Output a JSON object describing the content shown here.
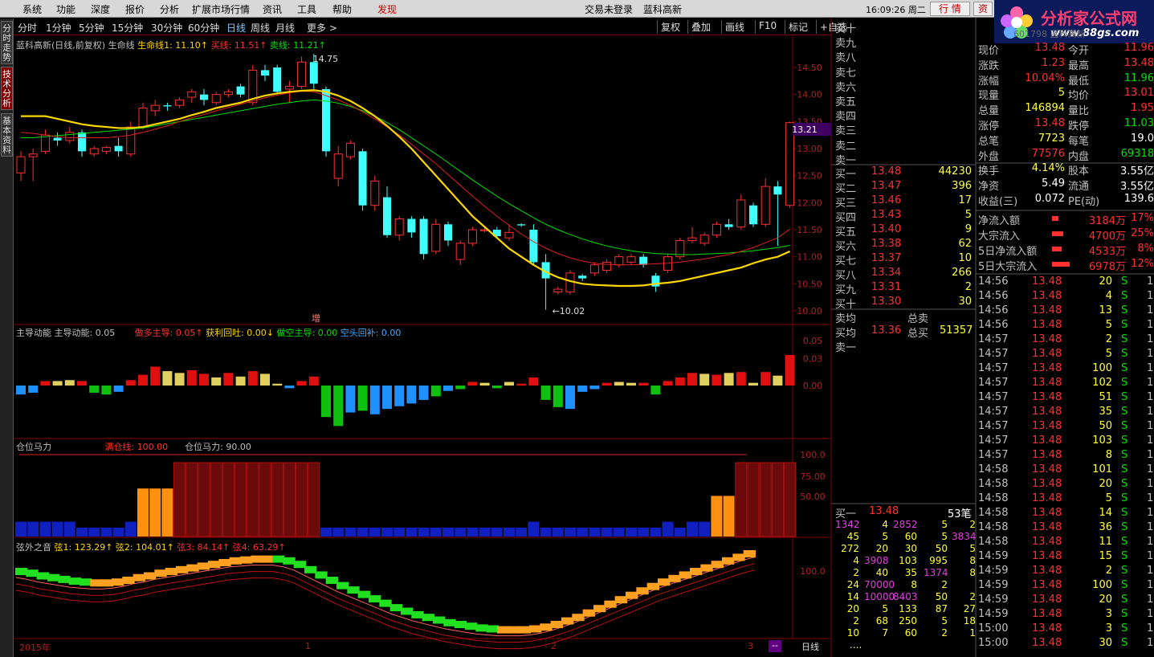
{
  "menu": [
    "系统",
    "功能",
    "深度",
    "报价",
    "分析",
    "扩展市场行情",
    "资讯",
    "工具",
    "帮助",
    "发现"
  ],
  "login_status": "交易未登录",
  "stock_name": "蓝科高新",
  "clock": "16:09:26 周二",
  "btn_quote": "行 情",
  "btn_trade": "资",
  "logo": {
    "name": "分析家公式网",
    "url": "www.88gs.com"
  },
  "left_tabs": [
    "分时走势",
    "技术分析",
    "基本资料"
  ],
  "periods": [
    "分时",
    "1分钟",
    "5分钟",
    "15分钟",
    "30分钟",
    "60分钟",
    "日线",
    "周线",
    "月线",
    "更多 >"
  ],
  "active_period": "日线",
  "tools": [
    "复权",
    "叠加",
    "画线",
    "F10",
    "标记",
    "+自选"
  ],
  "main_panel": {
    "title": "蓝科高新(日线,前复权) 生命线",
    "ind1": "生命线1: 11.10↑",
    "ind2": "买线: 11.51↑",
    "ind3": "卖线: 11.21↑",
    "high_mark": "14.75",
    "low_mark": "10.02",
    "tag": "增",
    "price_tag": "13.21",
    "y_ticks": [
      "14.50",
      "14.00",
      "13.50",
      "13.00",
      "12.50",
      "12.00",
      "11.50",
      "11.00",
      "10.50",
      "10.00"
    ]
  },
  "momentum_panel": {
    "title": "主导动能",
    "v1": "主导动能: 0.05",
    "v2": "做多主导: 0.05↑",
    "v3": "获利回吐: 0.00↓",
    "v4": "做空主导: 0.00",
    "v5": "空头回补: 0.00",
    "y_ticks": [
      "0.05",
      "0.03",
      "0.00"
    ]
  },
  "position_panel": {
    "title": "仓位马力",
    "v1": "满仓线: 100.00",
    "v2": "仓位马力: 90.00",
    "y_ticks": [
      "100.0",
      "75.00",
      "50.00"
    ]
  },
  "string_panel": {
    "title": "弦外之音",
    "v1": "弦1: 123.29↑",
    "v2": "弦2: 104.01↑",
    "v3": "弦3: 84.14↑",
    "v4": "弦4: 63.29↑",
    "y_ticks": [
      "100.0"
    ]
  },
  "x_axis": {
    "year": "2015年",
    "m1": "1",
    "m2": "2",
    "m3": "3",
    "period": "日线",
    "more": "--"
  },
  "colors": {
    "up": "#ff3030",
    "down": "#40ffff",
    "yellow": "#ffd700",
    "green": "#00e000",
    "grid": "#800000"
  },
  "chart_data": {
    "type": "candlestick",
    "series": [
      {
        "o": 12.55,
        "h": 12.95,
        "l": 12.4,
        "c": 12.85
      },
      {
        "o": 12.85,
        "h": 13.0,
        "l": 12.4,
        "c": 12.9
      },
      {
        "o": 12.95,
        "h": 13.35,
        "l": 12.9,
        "c": 13.25
      },
      {
        "o": 13.2,
        "h": 13.3,
        "l": 13.05,
        "c": 13.15
      },
      {
        "o": 13.15,
        "h": 13.4,
        "l": 13.1,
        "c": 13.3
      },
      {
        "o": 13.3,
        "h": 13.35,
        "l": 12.85,
        "c": 12.95
      },
      {
        "o": 12.9,
        "h": 13.05,
        "l": 12.85,
        "c": 13.0
      },
      {
        "o": 12.95,
        "h": 13.05,
        "l": 12.9,
        "c": 13.02
      },
      {
        "o": 13.05,
        "h": 13.2,
        "l": 12.85,
        "c": 12.95
      },
      {
        "o": 12.9,
        "h": 13.5,
        "l": 12.85,
        "c": 13.4
      },
      {
        "o": 13.4,
        "h": 13.85,
        "l": 13.35,
        "c": 13.75
      },
      {
        "o": 13.7,
        "h": 13.9,
        "l": 13.6,
        "c": 13.8
      },
      {
        "o": 13.8,
        "h": 13.85,
        "l": 13.7,
        "c": 13.78
      },
      {
        "o": 13.8,
        "h": 13.95,
        "l": 13.75,
        "c": 13.9
      },
      {
        "o": 13.95,
        "h": 14.1,
        "l": 13.85,
        "c": 14.05
      },
      {
        "o": 14.0,
        "h": 14.1,
        "l": 13.8,
        "c": 13.9
      },
      {
        "o": 13.85,
        "h": 14.05,
        "l": 13.8,
        "c": 14.0
      },
      {
        "o": 14.0,
        "h": 14.1,
        "l": 13.95,
        "c": 14.05
      },
      {
        "o": 14.15,
        "h": 14.2,
        "l": 13.95,
        "c": 14.0
      },
      {
        "o": 13.85,
        "h": 14.55,
        "l": 13.8,
        "c": 14.45
      },
      {
        "o": 14.45,
        "h": 14.55,
        "l": 14.25,
        "c": 14.35
      },
      {
        "o": 14.5,
        "h": 14.55,
        "l": 14.0,
        "c": 14.05
      },
      {
        "o": 14.1,
        "h": 14.25,
        "l": 13.85,
        "c": 14.15
      },
      {
        "o": 14.15,
        "h": 14.7,
        "l": 14.1,
        "c": 14.6
      },
      {
        "o": 14.6,
        "h": 14.75,
        "l": 14.1,
        "c": 14.2
      },
      {
        "o": 14.1,
        "h": 14.15,
        "l": 12.85,
        "c": 12.95
      },
      {
        "o": 12.45,
        "h": 13.05,
        "l": 12.3,
        "c": 12.9
      },
      {
        "o": 12.85,
        "h": 13.15,
        "l": 12.8,
        "c": 13.1
      },
      {
        "o": 12.95,
        "h": 13.0,
        "l": 11.85,
        "c": 11.95
      },
      {
        "o": 11.95,
        "h": 12.5,
        "l": 11.85,
        "c": 12.4
      },
      {
        "o": 12.1,
        "h": 12.3,
        "l": 11.35,
        "c": 11.4
      },
      {
        "o": 11.4,
        "h": 11.75,
        "l": 11.3,
        "c": 11.7
      },
      {
        "o": 11.7,
        "h": 11.75,
        "l": 11.35,
        "c": 11.45
      },
      {
        "o": 11.7,
        "h": 11.75,
        "l": 10.95,
        "c": 11.05
      },
      {
        "o": 11.1,
        "h": 11.7,
        "l": 11.05,
        "c": 11.6
      },
      {
        "o": 11.6,
        "h": 11.65,
        "l": 11.2,
        "c": 11.3
      },
      {
        "o": 10.95,
        "h": 11.3,
        "l": 10.85,
        "c": 11.25
      },
      {
        "o": 11.25,
        "h": 11.55,
        "l": 11.2,
        "c": 11.5
      },
      {
        "o": 11.48,
        "h": 11.55,
        "l": 11.45,
        "c": 11.5
      },
      {
        "o": 11.5,
        "h": 11.55,
        "l": 11.35,
        "c": 11.38
      },
      {
        "o": 11.35,
        "h": 11.6,
        "l": 11.3,
        "c": 11.45
      },
      {
        "o": 11.6,
        "h": 11.62,
        "l": 11.55,
        "c": 11.58
      },
      {
        "o": 11.5,
        "h": 11.6,
        "l": 10.85,
        "c": 10.9
      },
      {
        "o": 10.9,
        "h": 11.05,
        "l": 10.02,
        "c": 10.6
      },
      {
        "o": 10.35,
        "h": 10.45,
        "l": 10.3,
        "c": 10.4
      },
      {
        "o": 10.35,
        "h": 10.75,
        "l": 10.3,
        "c": 10.7
      },
      {
        "o": 10.65,
        "h": 10.68,
        "l": 10.55,
        "c": 10.6
      },
      {
        "o": 10.7,
        "h": 10.9,
        "l": 10.65,
        "c": 10.85
      },
      {
        "o": 10.75,
        "h": 10.95,
        "l": 10.7,
        "c": 10.9
      },
      {
        "o": 10.85,
        "h": 11.05,
        "l": 10.8,
        "c": 11.0
      },
      {
        "o": 10.9,
        "h": 11.05,
        "l": 10.85,
        "c": 11.0
      },
      {
        "o": 11.0,
        "h": 11.05,
        "l": 10.8,
        "c": 10.85
      },
      {
        "o": 10.65,
        "h": 10.7,
        "l": 10.35,
        "c": 10.45
      },
      {
        "o": 10.75,
        "h": 11.05,
        "l": 10.7,
        "c": 11.0
      },
      {
        "o": 11.0,
        "h": 11.35,
        "l": 10.95,
        "c": 11.3
      },
      {
        "o": 11.3,
        "h": 11.55,
        "l": 11.25,
        "c": 11.35
      },
      {
        "o": 11.25,
        "h": 11.45,
        "l": 11.2,
        "c": 11.4
      },
      {
        "o": 11.4,
        "h": 11.65,
        "l": 11.35,
        "c": 11.6
      },
      {
        "o": 11.6,
        "h": 11.7,
        "l": 11.5,
        "c": 11.55
      },
      {
        "o": 11.55,
        "h": 12.15,
        "l": 11.5,
        "c": 12.05
      },
      {
        "o": 11.95,
        "h": 12.0,
        "l": 11.55,
        "c": 11.6
      },
      {
        "o": 11.6,
        "h": 12.45,
        "l": 11.55,
        "c": 12.3
      },
      {
        "o": 12.3,
        "h": 12.4,
        "l": 11.2,
        "c": 12.15
      },
      {
        "o": 11.95,
        "h": 13.5,
        "l": 11.9,
        "c": 13.48
      }
    ],
    "lifeline": [
      13.6,
      13.6,
      13.6,
      13.55,
      13.5,
      13.45,
      13.42,
      13.4,
      13.38,
      13.38,
      13.4,
      13.45,
      13.5,
      13.55,
      13.62,
      13.68,
      13.75,
      13.8,
      13.85,
      13.92,
      13.98,
      14.02,
      14.05,
      14.07,
      14.08,
      14.05,
      13.98,
      13.88,
      13.75,
      13.6,
      13.42,
      13.22,
      13.0,
      12.75,
      12.5,
      12.25,
      12.0,
      11.75,
      11.55,
      11.35,
      11.15,
      11.0,
      10.85,
      10.72,
      10.62,
      10.55,
      10.5,
      10.48,
      10.47,
      10.46,
      10.46,
      10.47,
      10.5,
      10.52,
      10.55,
      10.6,
      10.65,
      10.7,
      10.75,
      10.8,
      10.88,
      10.95,
      11.0,
      11.1
    ],
    "buyline": [
      13.3,
      13.28,
      13.25,
      13.22,
      13.2,
      13.2,
      13.2,
      13.2,
      13.22,
      13.25,
      13.3,
      13.36,
      13.42,
      13.5,
      13.57,
      13.63,
      13.7,
      13.76,
      13.82,
      13.88,
      13.94,
      13.99,
      14.03,
      14.06,
      14.05,
      13.98,
      13.9,
      13.8,
      13.68,
      13.55,
      13.4,
      13.25,
      13.08,
      12.9,
      12.72,
      12.52,
      12.32,
      12.12,
      11.93,
      11.75,
      11.58,
      11.42,
      11.28,
      11.16,
      11.06,
      10.98,
      10.92,
      10.88,
      10.86,
      10.85,
      10.85,
      10.86,
      10.87,
      10.88,
      10.9,
      10.93,
      10.96,
      11.0,
      11.04,
      11.1,
      11.17,
      11.26,
      11.35,
      11.51
    ],
    "sellline": [
      13.2,
      13.2,
      13.22,
      13.24,
      13.26,
      13.28,
      13.3,
      13.32,
      13.34,
      13.36,
      13.38,
      13.42,
      13.46,
      13.5,
      13.54,
      13.58,
      13.62,
      13.66,
      13.7,
      13.74,
      13.78,
      13.82,
      13.85,
      13.88,
      13.9,
      13.88,
      13.84,
      13.78,
      13.7,
      13.6,
      13.48,
      13.35,
      13.2,
      13.05,
      12.9,
      12.74,
      12.58,
      12.42,
      12.27,
      12.12,
      11.98,
      11.85,
      11.72,
      11.6,
      11.5,
      11.41,
      11.33,
      11.26,
      11.2,
      11.15,
      11.11,
      11.08,
      11.06,
      11.05,
      11.04,
      11.04,
      11.05,
      11.06,
      11.07,
      11.09,
      11.11,
      11.14,
      11.17,
      11.21
    ],
    "momentum": [
      -0.01,
      -0.008,
      0.005,
      0.005,
      0.006,
      0.005,
      -0.008,
      -0.01,
      -0.007,
      0.006,
      0.012,
      0.021,
      0.016,
      0.014,
      0.017,
      0.013,
      0.009,
      0.014,
      0.01,
      0.016,
      0.013,
      0.002,
      -0.003,
      0.005,
      0.01,
      -0.035,
      -0.045,
      -0.03,
      -0.028,
      -0.032,
      -0.026,
      -0.023,
      -0.02,
      -0.016,
      -0.012,
      -0.006,
      -0.004,
      0.004,
      0.003,
      -0.003,
      0.004,
      0.002,
      0.009,
      -0.016,
      -0.024,
      -0.026,
      -0.007,
      -0.004,
      0.003,
      0.004,
      0.003,
      0.003,
      -0.01,
      0.005,
      0.009,
      0.014,
      0.013,
      0.012,
      0.014,
      0.015,
      0.003,
      0.015,
      0.011,
      0.034
    ],
    "momentum_colors": [
      "b",
      "b",
      "r",
      "y",
      "y",
      "r",
      "g",
      "g",
      "b",
      "r",
      "r",
      "r",
      "y",
      "y",
      "r",
      "r",
      "y",
      "r",
      "y",
      "r",
      "y",
      "y",
      "b",
      "r",
      "r",
      "g",
      "g",
      "b",
      "g",
      "b",
      "b",
      "b",
      "b",
      "b",
      "g",
      "b",
      "g",
      "r",
      "y",
      "g",
      "y",
      "r",
      "r",
      "g",
      "g",
      "b",
      "b",
      "b",
      "r",
      "y",
      "y",
      "r",
      "g",
      "r",
      "r",
      "r",
      "y",
      "r",
      "y",
      "r",
      "y",
      "r",
      "y",
      "r"
    ],
    "position": [
      20,
      20,
      20,
      20,
      20,
      12,
      12,
      12,
      12,
      20,
      65,
      65,
      65,
      100,
      100,
      100,
      100,
      100,
      100,
      100,
      100,
      100,
      100,
      100,
      100,
      12,
      12,
      12,
      12,
      12,
      12,
      12,
      12,
      12,
      12,
      12,
      12,
      12,
      12,
      12,
      12,
      12,
      20,
      12,
      12,
      12,
      12,
      12,
      12,
      12,
      12,
      12,
      12,
      20,
      12,
      20,
      20,
      55,
      55,
      100,
      100,
      100,
      100,
      100,
      100
    ],
    "position_colors": [
      "b",
      "b",
      "b",
      "b",
      "b",
      "b",
      "b",
      "b",
      "b",
      "b",
      "o",
      "o",
      "o",
      "m",
      "m",
      "m",
      "m",
      "m",
      "m",
      "m",
      "m",
      "m",
      "m",
      "m",
      "m",
      "b",
      "b",
      "b",
      "b",
      "b",
      "b",
      "b",
      "b",
      "b",
      "b",
      "b",
      "b",
      "b",
      "b",
      "b",
      "b",
      "b",
      "b",
      "b",
      "b",
      "b",
      "b",
      "b",
      "b",
      "b",
      "b",
      "b",
      "b",
      "b",
      "b",
      "b",
      "b",
      "o",
      "o",
      "m",
      "m",
      "m",
      "m",
      "m",
      "m"
    ],
    "strings": [
      100,
      98,
      95,
      93,
      91,
      89,
      88,
      87,
      87,
      88,
      90,
      93,
      95,
      98,
      100,
      102,
      104,
      106,
      108,
      110,
      112,
      113,
      114,
      114,
      114,
      112,
      108,
      102,
      96,
      90,
      84,
      79,
      74,
      69,
      64,
      59,
      55,
      51,
      48,
      45,
      42,
      40,
      38,
      36,
      35,
      34,
      34,
      34,
      35,
      37,
      40,
      44,
      48,
      53,
      58,
      63,
      68,
      73,
      78,
      83,
      88,
      92,
      96,
      100,
      104,
      108,
      112,
      116,
      120,
      123
    ]
  },
  "order_book": {
    "sell": [
      [
        "卖十",
        "",
        ""
      ],
      [
        "卖九",
        "",
        ""
      ],
      [
        "卖八",
        "",
        ""
      ],
      [
        "卖七",
        "",
        ""
      ],
      [
        "卖六",
        "",
        ""
      ],
      [
        "卖五",
        "",
        ""
      ],
      [
        "卖四",
        "",
        ""
      ],
      [
        "卖三",
        "",
        ""
      ],
      [
        "卖二",
        "",
        ""
      ],
      [
        "卖一",
        "",
        ""
      ]
    ],
    "buy": [
      [
        "买一",
        "13.48",
        "44230"
      ],
      [
        "买二",
        "13.47",
        "396"
      ],
      [
        "买三",
        "13.46",
        "17"
      ],
      [
        "买四",
        "13.43",
        "5"
      ],
      [
        "买五",
        "13.40",
        "9"
      ],
      [
        "买六",
        "13.38",
        "62"
      ],
      [
        "买七",
        "13.37",
        "10"
      ],
      [
        "买八",
        "13.34",
        "266"
      ],
      [
        "买九",
        "13.31",
        "2"
      ],
      [
        "买十",
        "13.30",
        "30"
      ]
    ],
    "sell_avg_label": "卖均",
    "total_sell_label": "总卖",
    "buy_avg_label": "买均",
    "buy_avg": "13.36",
    "total_buy_label": "总买",
    "total_buy": "51357",
    "sell1_label": "卖一",
    "queue_label": "买一",
    "queue_price": "13.48",
    "queue_count": "53笔",
    "queue": [
      [
        "1342",
        "4",
        "2852",
        "5",
        "2"
      ],
      [
        "45",
        "5",
        "60",
        "5",
        "3834"
      ],
      [
        "272",
        "20",
        "30",
        "50",
        "5"
      ],
      [
        "4",
        "3908",
        "103",
        "995",
        "8"
      ],
      [
        "2",
        "40",
        "35",
        "1374",
        "8"
      ],
      [
        "24",
        "70000",
        "8",
        "2",
        ""
      ],
      [
        "14",
        "10000",
        "8403",
        "50",
        "2"
      ],
      [
        "20",
        "5",
        "133",
        "87",
        "27"
      ],
      [
        "2",
        "68",
        "250",
        "5",
        "18"
      ],
      [
        "10",
        "7",
        "60",
        "2",
        "1"
      ]
    ],
    "queue_more": "...."
  },
  "stats": {
    "code_hint": "601798 蓝科高新",
    "rows": [
      [
        "现价",
        "13.48",
        "今开",
        "11.96"
      ],
      [
        "涨跌",
        "1.23",
        "最高",
        "13.48"
      ],
      [
        "涨幅",
        "10.04%",
        "最低",
        "11.96"
      ],
      [
        "现量",
        "5",
        "均价",
        "13.01"
      ],
      [
        "总量",
        "146894",
        "量比",
        "1.95"
      ],
      [
        "涨停",
        "13.48",
        "跌停",
        "11.03"
      ],
      [
        "总笔",
        "7723",
        "每笔",
        "19.0"
      ],
      [
        "外盘",
        "77576",
        "内盘",
        "69318"
      ],
      [
        "换手",
        "4.14%",
        "股本",
        "3.55亿"
      ],
      [
        "净资",
        "5.49",
        "流通",
        "3.55亿"
      ],
      [
        "收益(三)",
        "0.072",
        "PE(动)",
        "139.6"
      ]
    ],
    "flows": [
      [
        "净流入额",
        "3184万",
        "17%"
      ],
      [
        "大宗流入",
        "4700万",
        "25%"
      ],
      [
        "5日净流入额",
        "4533万",
        "8%"
      ],
      [
        "5日大宗流入",
        "6978万",
        "12%"
      ]
    ]
  },
  "ticks": [
    [
      "14:56",
      "13.48",
      "20",
      "S",
      "1"
    ],
    [
      "14:56",
      "13.48",
      "4",
      "S",
      "1"
    ],
    [
      "14:56",
      "13.48",
      "13",
      "S",
      "1"
    ],
    [
      "14:56",
      "13.48",
      "5",
      "S",
      "1"
    ],
    [
      "14:57",
      "13.48",
      "2",
      "S",
      "1"
    ],
    [
      "14:57",
      "13.48",
      "5",
      "S",
      "1"
    ],
    [
      "14:57",
      "13.48",
      "100",
      "S",
      "1"
    ],
    [
      "14:57",
      "13.48",
      "102",
      "S",
      "1"
    ],
    [
      "14:57",
      "13.48",
      "51",
      "S",
      "1"
    ],
    [
      "14:57",
      "13.48",
      "35",
      "S",
      "1"
    ],
    [
      "14:57",
      "13.48",
      "50",
      "S",
      "1"
    ],
    [
      "14:57",
      "13.48",
      "103",
      "S",
      "1"
    ],
    [
      "14:57",
      "13.48",
      "8",
      "S",
      "1"
    ],
    [
      "14:58",
      "13.48",
      "101",
      "S",
      "1"
    ],
    [
      "14:58",
      "13.48",
      "20",
      "S",
      "1"
    ],
    [
      "14:58",
      "13.48",
      "5",
      "S",
      "1"
    ],
    [
      "14:58",
      "13.48",
      "14",
      "S",
      "1"
    ],
    [
      "14:58",
      "13.48",
      "36",
      "S",
      "1"
    ],
    [
      "14:58",
      "13.48",
      "11",
      "S",
      "1"
    ],
    [
      "14:59",
      "13.48",
      "15",
      "S",
      "1"
    ],
    [
      "14:59",
      "13.48",
      "2",
      "S",
      "1"
    ],
    [
      "14:59",
      "13.48",
      "100",
      "S",
      "1"
    ],
    [
      "14:59",
      "13.48",
      "20",
      "S",
      "1"
    ],
    [
      "14:59",
      "13.48",
      "3",
      "S",
      "1"
    ],
    [
      "15:00",
      "13.48",
      "3",
      "S",
      "1"
    ],
    [
      "15:00",
      "13.48",
      "30",
      "S",
      "1"
    ]
  ]
}
